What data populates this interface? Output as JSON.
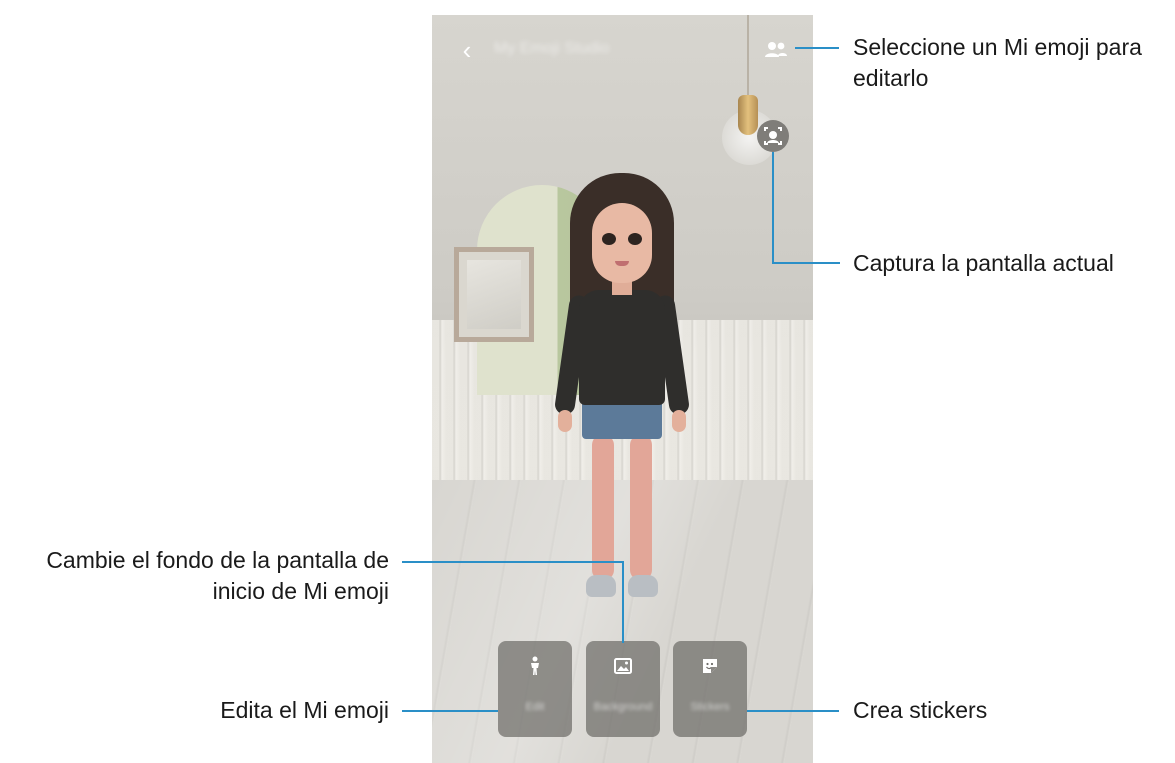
{
  "app": {
    "title": "My Emoji Studio",
    "back_icon": "back-arrow-icon",
    "users_icon": "people-icon",
    "capture_icon": "face-capture-icon"
  },
  "buttons": [
    {
      "label": "Edit",
      "icon": "person-icon"
    },
    {
      "label": "Background",
      "icon": "image-icon"
    },
    {
      "label": "Stickers",
      "icon": "sticker-icon"
    }
  ],
  "callouts": {
    "select_emoji": {
      "line1": "Seleccione un Mi emoji para",
      "line2": "editarlo"
    },
    "capture": "Captura la pantalla actual",
    "background": {
      "line1": "Cambie el fondo de la pantalla de",
      "line2": "inicio de Mi emoji"
    },
    "edit": "Edita el Mi emoji",
    "stickers": "Crea stickers"
  },
  "colors": {
    "callout_line": "#2a8fc7",
    "button_tile": "#6e6c68"
  }
}
